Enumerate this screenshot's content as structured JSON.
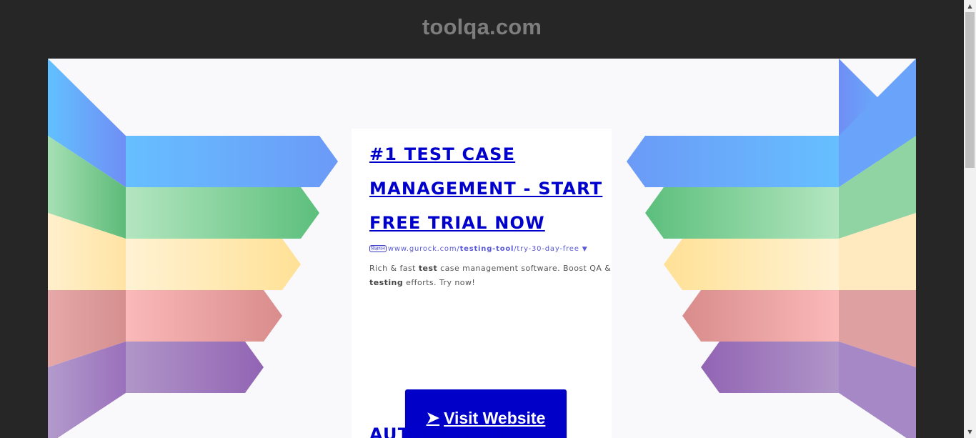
{
  "site": {
    "title": "toolqa.com"
  },
  "ad": {
    "headline": "#1 TEST CASE MANAGEMENT - START FREE TRIAL NOW",
    "badge": "विज्ञापन",
    "url_prefix": "www.gurock.com/",
    "url_bold": "testing-tool",
    "url_suffix": "/try-30-day-free",
    "url_caret": "▼",
    "desc_part1": "Rich & fast ",
    "desc_bold1": "test",
    "desc_part2": " case management software. Boost QA & ",
    "desc_bold2": "testing",
    "desc_part3": " efforts. Try now!",
    "cta_arrow": "➤",
    "cta_label": "Visit Website"
  },
  "next_ad": {
    "headline": "AUTOMATED"
  },
  "colors": {
    "page_bg": "#262626",
    "link_blue": "#0000cc",
    "cta_bg": "#0000c8",
    "stripe_blue": "#66bbff",
    "stripe_green": "#6cc487",
    "stripe_yellow": "#ffe49a",
    "stripe_red": "#f5b2b2",
    "stripe_purple": "#9b6fb8"
  }
}
